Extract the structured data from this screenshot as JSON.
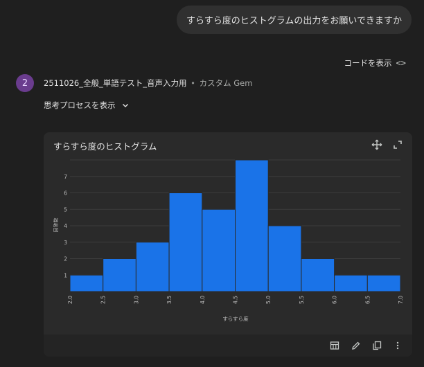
{
  "user_message": "すらすら度のヒストグラムの出力をお願いできますか",
  "show_code_label": "コードを表示",
  "gem": {
    "avatar_number": "2",
    "name": "2511026_全般_単語テスト_音声入力用",
    "separator": "•",
    "suffix": "カスタム Gem"
  },
  "thinking_label": "思考プロセスを表示",
  "colors": {
    "background": "#1f1f1f",
    "card": "#2a2a2a",
    "bar": "#1a73e8",
    "avatar": "#6a3c8e"
  },
  "icons": {
    "show_code": "code-brackets-icon",
    "thinking": "chevron-down-icon",
    "move": "move-icon",
    "expand": "expand-icon",
    "table": "table-icon",
    "edit": "pencil-icon",
    "copy": "copy-icon",
    "more": "more-vert-icon"
  },
  "chart_data": {
    "type": "bar",
    "title": "すらすら度のヒストグラム",
    "xlabel": "すらすら度",
    "ylabel": "回答数",
    "bin_edges": [
      2.0,
      2.5,
      3.0,
      3.5,
      4.0,
      4.5,
      5.0,
      5.5,
      6.0,
      6.5,
      7.0
    ],
    "values": [
      1,
      2,
      3,
      6,
      5,
      8,
      4,
      2,
      1,
      1
    ],
    "x_tick_labels": [
      "2.0",
      "2.5",
      "3.0",
      "3.5",
      "4.0",
      "4.5",
      "5.0",
      "5.5",
      "6.0",
      "6.5",
      "7.0"
    ],
    "y_tick_labels": [
      "1",
      "2",
      "3",
      "4",
      "5",
      "6",
      "7"
    ],
    "xlim": [
      2.0,
      7.0
    ],
    "ylim": [
      0,
      8
    ],
    "grid": true,
    "legend": false
  }
}
